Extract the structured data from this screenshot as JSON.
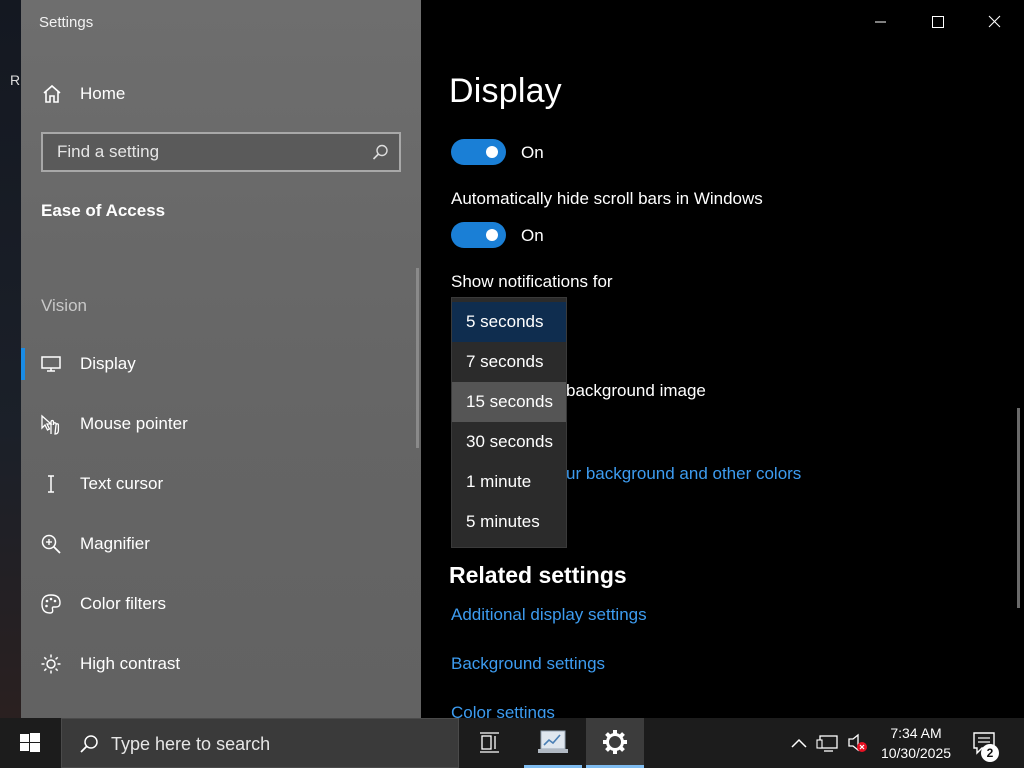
{
  "desktop": {
    "letter": "R"
  },
  "window": {
    "title": "Settings",
    "sidebar": {
      "home_label": "Home",
      "search_placeholder": "Find a setting",
      "section_title": "Ease of Access",
      "group_label": "Vision",
      "items": [
        {
          "label": "Display",
          "icon": "monitor-icon"
        },
        {
          "label": "Mouse pointer",
          "icon": "mouse-pointer-icon"
        },
        {
          "label": "Text cursor",
          "icon": "text-cursor-icon"
        },
        {
          "label": "Magnifier",
          "icon": "magnifier-icon"
        },
        {
          "label": "Color filters",
          "icon": "palette-icon"
        },
        {
          "label": "High contrast",
          "icon": "sun-icon"
        }
      ]
    },
    "content": {
      "page_title": "Display",
      "toggle1": {
        "state_label": "On"
      },
      "scrollbars": {
        "label": "Automatically hide scroll bars in Windows",
        "state_label": "On"
      },
      "notifications": {
        "label": "Show notifications for",
        "options": [
          "5 seconds",
          "7 seconds",
          "15 seconds",
          "30 seconds",
          "1 minute",
          "5 minutes"
        ],
        "selected": "5 seconds",
        "hovered": "15 seconds"
      },
      "behind_text": "background image",
      "behind_link": "ur background and other colors",
      "related": {
        "title": "Related settings",
        "links": [
          "Additional display settings",
          "Background settings",
          "Color settings"
        ]
      }
    }
  },
  "taskbar": {
    "search_placeholder": "Type here to search",
    "time": "7:34 AM",
    "date": "10/30/2025",
    "notification_count": "2"
  },
  "colors": {
    "accent": "#1a7fd6",
    "link": "#3d9cf0",
    "sidebar_bg": "#686868",
    "content_bg": "#000000",
    "taskbar_bg": "#1c1c1c"
  }
}
